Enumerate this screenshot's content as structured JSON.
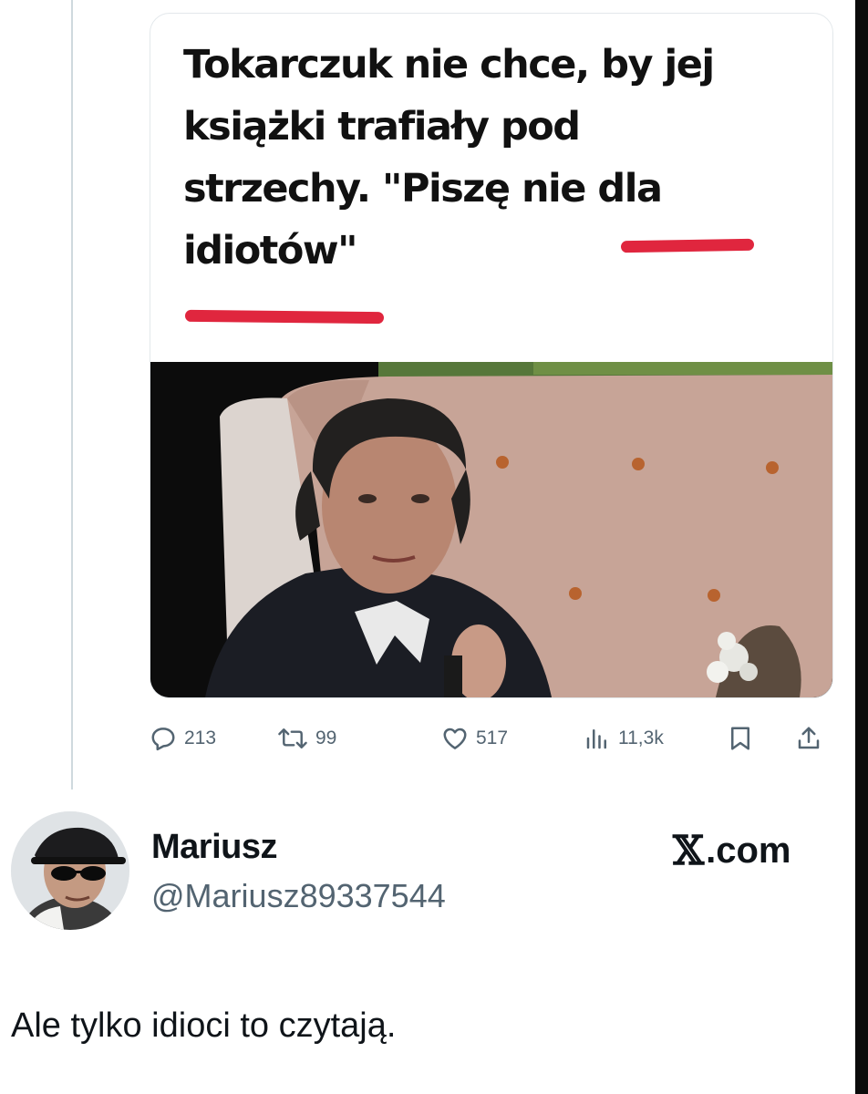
{
  "quoted_card": {
    "headline": "Tokarczuk nie chce, by jej\nksiążki trafiały pod\nstrzechy. \"Piszę nie dla\nidiotów\""
  },
  "metrics": {
    "replies": "213",
    "reposts": "99",
    "likes": "517",
    "views": "11,3k"
  },
  "colors": {
    "underline": "#e0263e",
    "metric_gray": "#536471"
  },
  "author": {
    "name": "Mariusz",
    "handle": "@Mariusz89337544"
  },
  "watermark": {
    "x_mark": "𝕏",
    "domain": ".com"
  },
  "tweet": {
    "text": "Ale tylko idioci to czytają."
  },
  "icons": [
    "reply-icon",
    "repost-icon",
    "like-icon",
    "views-icon",
    "bookmark-icon",
    "share-icon"
  ]
}
